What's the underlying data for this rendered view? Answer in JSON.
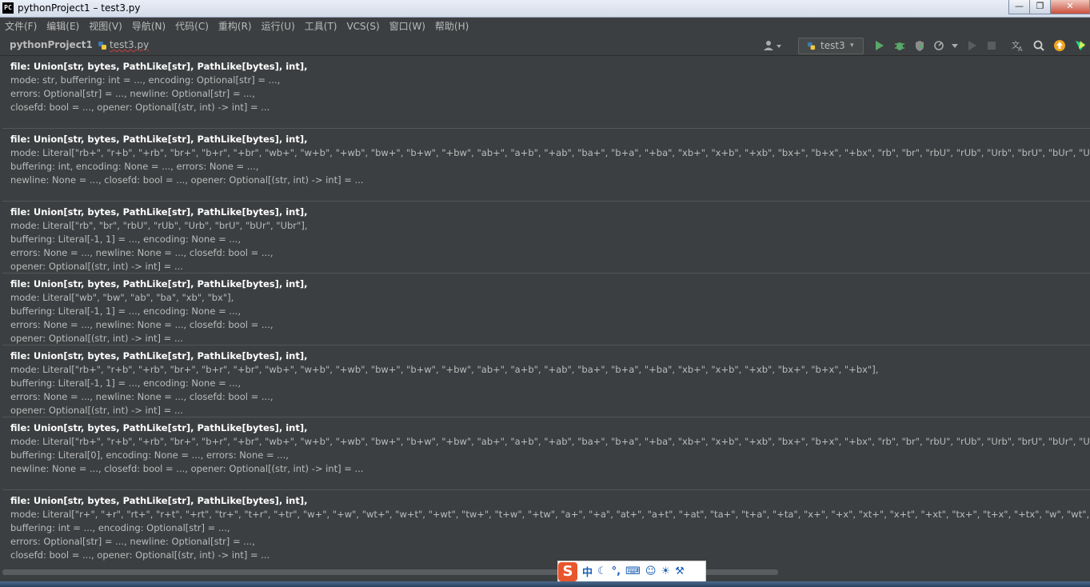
{
  "window": {
    "title": "pythonProject1 – test3.py",
    "app_icon": "PC",
    "minimize_icon": "—",
    "maximize_icon": "❐",
    "close_icon": "✕"
  },
  "menu": [
    "文件(F)",
    "编辑(E)",
    "视图(V)",
    "导航(N)",
    "代码(C)",
    "重构(R)",
    "运行(U)",
    "工具(T)",
    "VCS(S)",
    "窗口(W)",
    "帮助(H)"
  ],
  "nav": {
    "project": "pythonProject1",
    "separator": "›",
    "file": "test3.py",
    "run_config": "test3",
    "dropdown_icon": "▾"
  },
  "signatures": [
    {
      "lines": [
        "file: Union[str, bytes, PathLike[str], PathLike[bytes], int],",
        "mode: str, buffering: int = ..., encoding: Optional[str] = ...,",
        "errors: Optional[str] = ..., newline: Optional[str] = ...,",
        "closefd: bool = ..., opener: Optional[(str, int) -> int] = ..."
      ]
    },
    {
      "lines": [
        "file: Union[str, bytes, PathLike[str], PathLike[bytes], int],",
        "mode: Literal[\"rb+\", \"r+b\", \"+rb\", \"br+\", \"b+r\", \"+br\", \"wb+\", \"w+b\", \"+wb\", \"bw+\", \"b+w\", \"+bw\", \"ab+\", \"a+b\", \"+ab\", \"ba+\", \"b+a\", \"+ba\", \"xb+\", \"x+b\", \"+xb\", \"bx+\", \"b+x\", \"+bx\", \"rb\", \"br\", \"rbU\", \"rUb\", \"Urb\", \"brU\", \"bUr\", \"Ubr\",",
        "buffering: int, encoding: None = ..., errors: None = ...,",
        "newline: None = ..., closefd: bool = ..., opener: Optional[(str, int) -> int] = ..."
      ]
    },
    {
      "lines": [
        "file: Union[str, bytes, PathLike[str], PathLike[bytes], int],",
        "mode: Literal[\"rb\", \"br\", \"rbU\", \"rUb\", \"Urb\", \"brU\", \"bUr\", \"Ubr\"],",
        "buffering: Literal[-1, 1] = ..., encoding: None = ...,",
        "errors: None = ..., newline: None = ..., closefd: bool = ...,",
        "opener: Optional[(str, int) -> int] = ..."
      ]
    },
    {
      "lines": [
        "file: Union[str, bytes, PathLike[str], PathLike[bytes], int],",
        "mode: Literal[\"wb\", \"bw\", \"ab\", \"ba\", \"xb\", \"bx\"],",
        "buffering: Literal[-1, 1] = ..., encoding: None = ...,",
        "errors: None = ..., newline: None = ..., closefd: bool = ...,",
        "opener: Optional[(str, int) -> int] = ..."
      ]
    },
    {
      "lines": [
        "file: Union[str, bytes, PathLike[str], PathLike[bytes], int],",
        "mode: Literal[\"rb+\", \"r+b\", \"+rb\", \"br+\", \"b+r\", \"+br\", \"wb+\", \"w+b\", \"+wb\", \"bw+\", \"b+w\", \"+bw\", \"ab+\", \"a+b\", \"+ab\", \"ba+\", \"b+a\", \"+ba\", \"xb+\", \"x+b\", \"+xb\", \"bx+\", \"b+x\", \"+bx\"],",
        "buffering: Literal[-1, 1] = ..., encoding: None = ...,",
        "errors: None = ..., newline: None = ..., closefd: bool = ...,",
        "opener: Optional[(str, int) -> int] = ..."
      ]
    },
    {
      "lines": [
        "file: Union[str, bytes, PathLike[str], PathLike[bytes], int],",
        "mode: Literal[\"rb+\", \"r+b\", \"+rb\", \"br+\", \"b+r\", \"+br\", \"wb+\", \"w+b\", \"+wb\", \"bw+\", \"b+w\", \"+bw\", \"ab+\", \"a+b\", \"+ab\", \"ba+\", \"b+a\", \"+ba\", \"xb+\", \"x+b\", \"+xb\", \"bx+\", \"b+x\", \"+bx\", \"rb\", \"br\", \"rbU\", \"rUb\", \"Urb\", \"brU\", \"bUr\", \"Ubr\",",
        "buffering: Literal[0], encoding: None = ..., errors: None = ...,",
        "newline: None = ..., closefd: bool = ..., opener: Optional[(str, int) -> int] = ..."
      ]
    },
    {
      "lines": [
        "file: Union[str, bytes, PathLike[str], PathLike[bytes], int],",
        "mode: Literal[\"r+\", \"+r\", \"rt+\", \"r+t\", \"+rt\", \"tr+\", \"t+r\", \"+tr\", \"w+\", \"+w\", \"wt+\", \"w+t\", \"+wt\", \"tw+\", \"t+w\", \"+tw\", \"a+\", \"+a\", \"at+\", \"a+t\", \"+at\", \"ta+\", \"t+a\", \"+ta\", \"x+\", \"+x\", \"xt+\", \"x+t\", \"+xt\", \"tx+\", \"t+x\", \"+tx\", \"w\", \"wt\", \"tw\", \"a\", \"at\"",
        "buffering: int = ..., encoding: Optional[str] = ...,",
        "errors: Optional[str] = ..., newline: Optional[str] = ...,",
        "closefd: bool = ..., opener: Optional[(str, int) -> int] = ..."
      ]
    }
  ],
  "ime": {
    "logo": "S",
    "lang": "中",
    "moon_icon": "☾",
    "punct_icon": "°,",
    "keyboard_icon": "⌨",
    "user_icon": "☺",
    "shirt_icon": "☀",
    "wrench_icon": "⚒"
  },
  "colors": {
    "background": "#3c3f41",
    "text": "#bbbbbb",
    "bold_text": "#ffffff",
    "run_green": "#59a869",
    "ime_orange": "#e8562c"
  }
}
